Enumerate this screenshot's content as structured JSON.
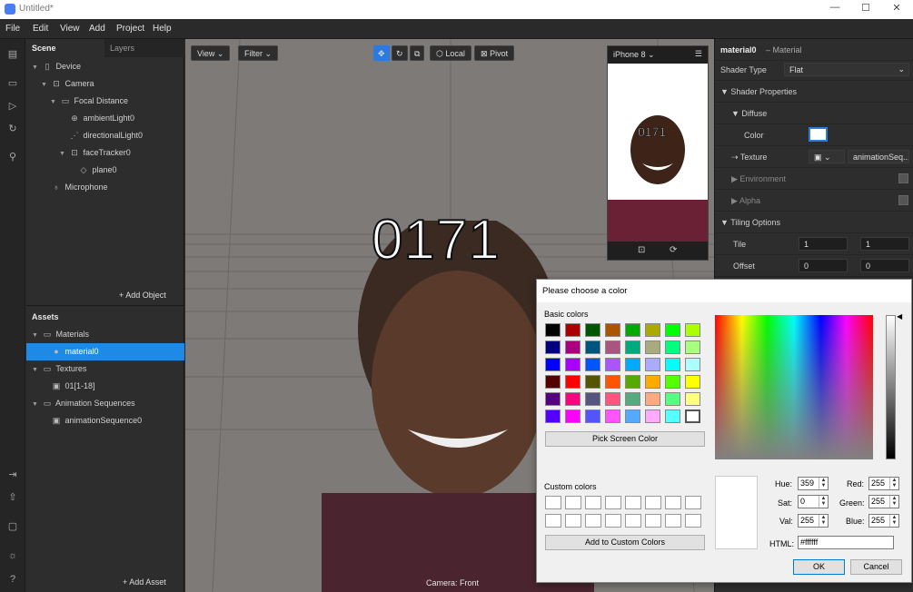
{
  "window": {
    "title": "Untitled*",
    "minimize": "—",
    "maximize": "☐",
    "close": "✕"
  },
  "menu": [
    "File",
    "Edit",
    "View",
    "Add",
    "Project",
    "Help"
  ],
  "scene_panel": {
    "tabs": [
      "Scene",
      "Layers"
    ],
    "items": [
      {
        "label": "Device",
        "icon": "▯",
        "depth": 0,
        "expanded": true
      },
      {
        "label": "Camera",
        "icon": "⊡",
        "depth": 1,
        "expanded": true
      },
      {
        "label": "Focal Distance",
        "icon": "▭",
        "depth": 2,
        "expanded": true
      },
      {
        "label": "ambientLight0",
        "icon": "⊕",
        "depth": 3
      },
      {
        "label": "directionalLight0",
        "icon": "⋰",
        "depth": 3
      },
      {
        "label": "faceTracker0",
        "icon": "⊡",
        "depth": 3,
        "expanded": true
      },
      {
        "label": "plane0",
        "icon": "◇",
        "depth": 4
      },
      {
        "label": "Microphone",
        "icon": "🎙",
        "depth": 1
      }
    ],
    "add_object": "+ Add Object"
  },
  "assets_panel": {
    "title": "Assets",
    "items": [
      {
        "label": "Materials",
        "icon": "🗀",
        "depth": 0,
        "expanded": true
      },
      {
        "label": "material0",
        "icon": "●",
        "depth": 1,
        "selected": true
      },
      {
        "label": "Textures",
        "icon": "🗀",
        "depth": 0,
        "expanded": true
      },
      {
        "label": "01[1-18]",
        "icon": "▣",
        "depth": 1
      },
      {
        "label": "Animation Sequences",
        "icon": "🗀",
        "depth": 0,
        "expanded": true
      },
      {
        "label": "animationSequence0",
        "icon": "▣",
        "depth": 1
      }
    ],
    "add_asset": "+ Add Asset"
  },
  "viewport": {
    "view_btn": "View",
    "filter_btn": "Filter",
    "local_btn": "Local",
    "pivot_btn": "Pivot",
    "overlay_text": "0171",
    "camera_label": "Camera: Front",
    "device": "iPhone 8",
    "phone_overlay_text": "0171"
  },
  "inspector": {
    "name": "material0",
    "kind": "– Material",
    "shader_type_label": "Shader Type",
    "shader_type_value": "Flat",
    "shader_properties": "Shader Properties",
    "diffuse": "Diffuse",
    "color_label": "Color",
    "texture_label": "Texture",
    "texture_value": "animationSeq...",
    "environment": "Environment",
    "alpha": "Alpha",
    "tiling_options": "Tiling Options",
    "tile_label": "Tile",
    "tile_x": "1",
    "tile_y": "1",
    "offset_label": "Offset",
    "offset_x": "0",
    "offset_y": "0"
  },
  "color_dialog": {
    "title": "Please choose a color",
    "basic_colors_label": "Basic colors",
    "basic_colors": [
      "#000000",
      "#aa0000",
      "#005500",
      "#aa5500",
      "#00aa00",
      "#aaaa00",
      "#00ff00",
      "#aaff00",
      "#00007f",
      "#aa007f",
      "#00557f",
      "#aa557f",
      "#00aa7f",
      "#aaaa7f",
      "#00ff7f",
      "#aaff7f",
      "#0000ff",
      "#aa00ff",
      "#0055ff",
      "#aa55ff",
      "#00aaff",
      "#aaaaff",
      "#00ffff",
      "#aaffff",
      "#550000",
      "#ff0000",
      "#555500",
      "#ff5500",
      "#55aa00",
      "#ffaa00",
      "#55ff00",
      "#ffff00",
      "#55007f",
      "#ff007f",
      "#55557f",
      "#ff557f",
      "#55aa7f",
      "#ffaa7f",
      "#55ff7f",
      "#ffff7f",
      "#5500ff",
      "#ff00ff",
      "#5555ff",
      "#ff55ff",
      "#55aaff",
      "#ffaaff",
      "#55ffff",
      "#ffffff"
    ],
    "pick_screen": "Pick Screen Color",
    "custom_colors_label": "Custom colors",
    "add_custom": "Add to Custom Colors",
    "hue_label": "Hue:",
    "hue": "359",
    "sat_label": "Sat:",
    "sat": "0",
    "val_label": "Val:",
    "val": "255",
    "red_label": "Red:",
    "red": "255",
    "green_label": "Green:",
    "green": "255",
    "blue_label": "Blue:",
    "blue": "255",
    "html_label": "HTML:",
    "html": "#ffffff",
    "ok": "OK",
    "cancel": "Cancel"
  }
}
